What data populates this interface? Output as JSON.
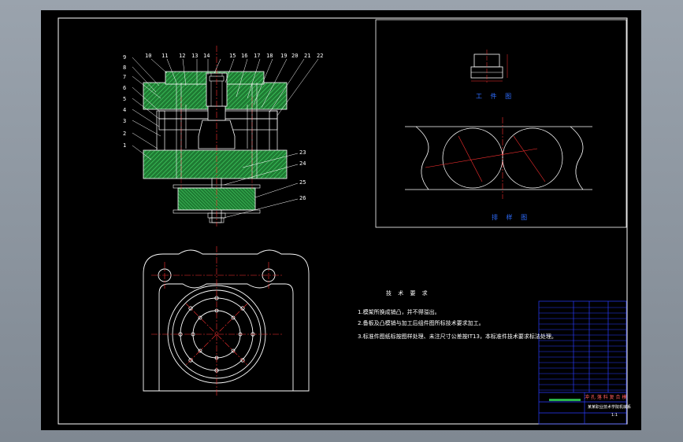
{
  "drawing": {
    "part_numbers": [
      "1",
      "2",
      "3",
      "4",
      "5",
      "6",
      "7",
      "8",
      "9",
      "10",
      "11",
      "12",
      "13",
      "14",
      "15",
      "16",
      "17",
      "18",
      "19",
      "20",
      "21",
      "22",
      "23",
      "24",
      "25",
      "26"
    ],
    "views": {
      "workpiece_caption": "工 件 图",
      "layout_caption": "排 样 图"
    },
    "tech_requirements": {
      "title": "技 术 要 求",
      "items": [
        "1.模架所换成销凸，并不得溢出。",
        "2.备板及凸模销与加工后组件图所标技术要求加工。",
        "3.标准件图纸标按图样处理、未注尺寸公差按IT13，本标准件技术要求标法处理。"
      ]
    },
    "title_block": {
      "drawing_name": "冲 孔 落 料 复 合 模",
      "school": "某某职业技术学院机械系",
      "scale": "1:1"
    },
    "colors": {
      "sheet": "#000000",
      "outline": "#ffffff",
      "centerline": "#ff3030",
      "hatch": "#29b34a",
      "caption": "#2e6dff",
      "title_block": "#2a3cff"
    }
  }
}
